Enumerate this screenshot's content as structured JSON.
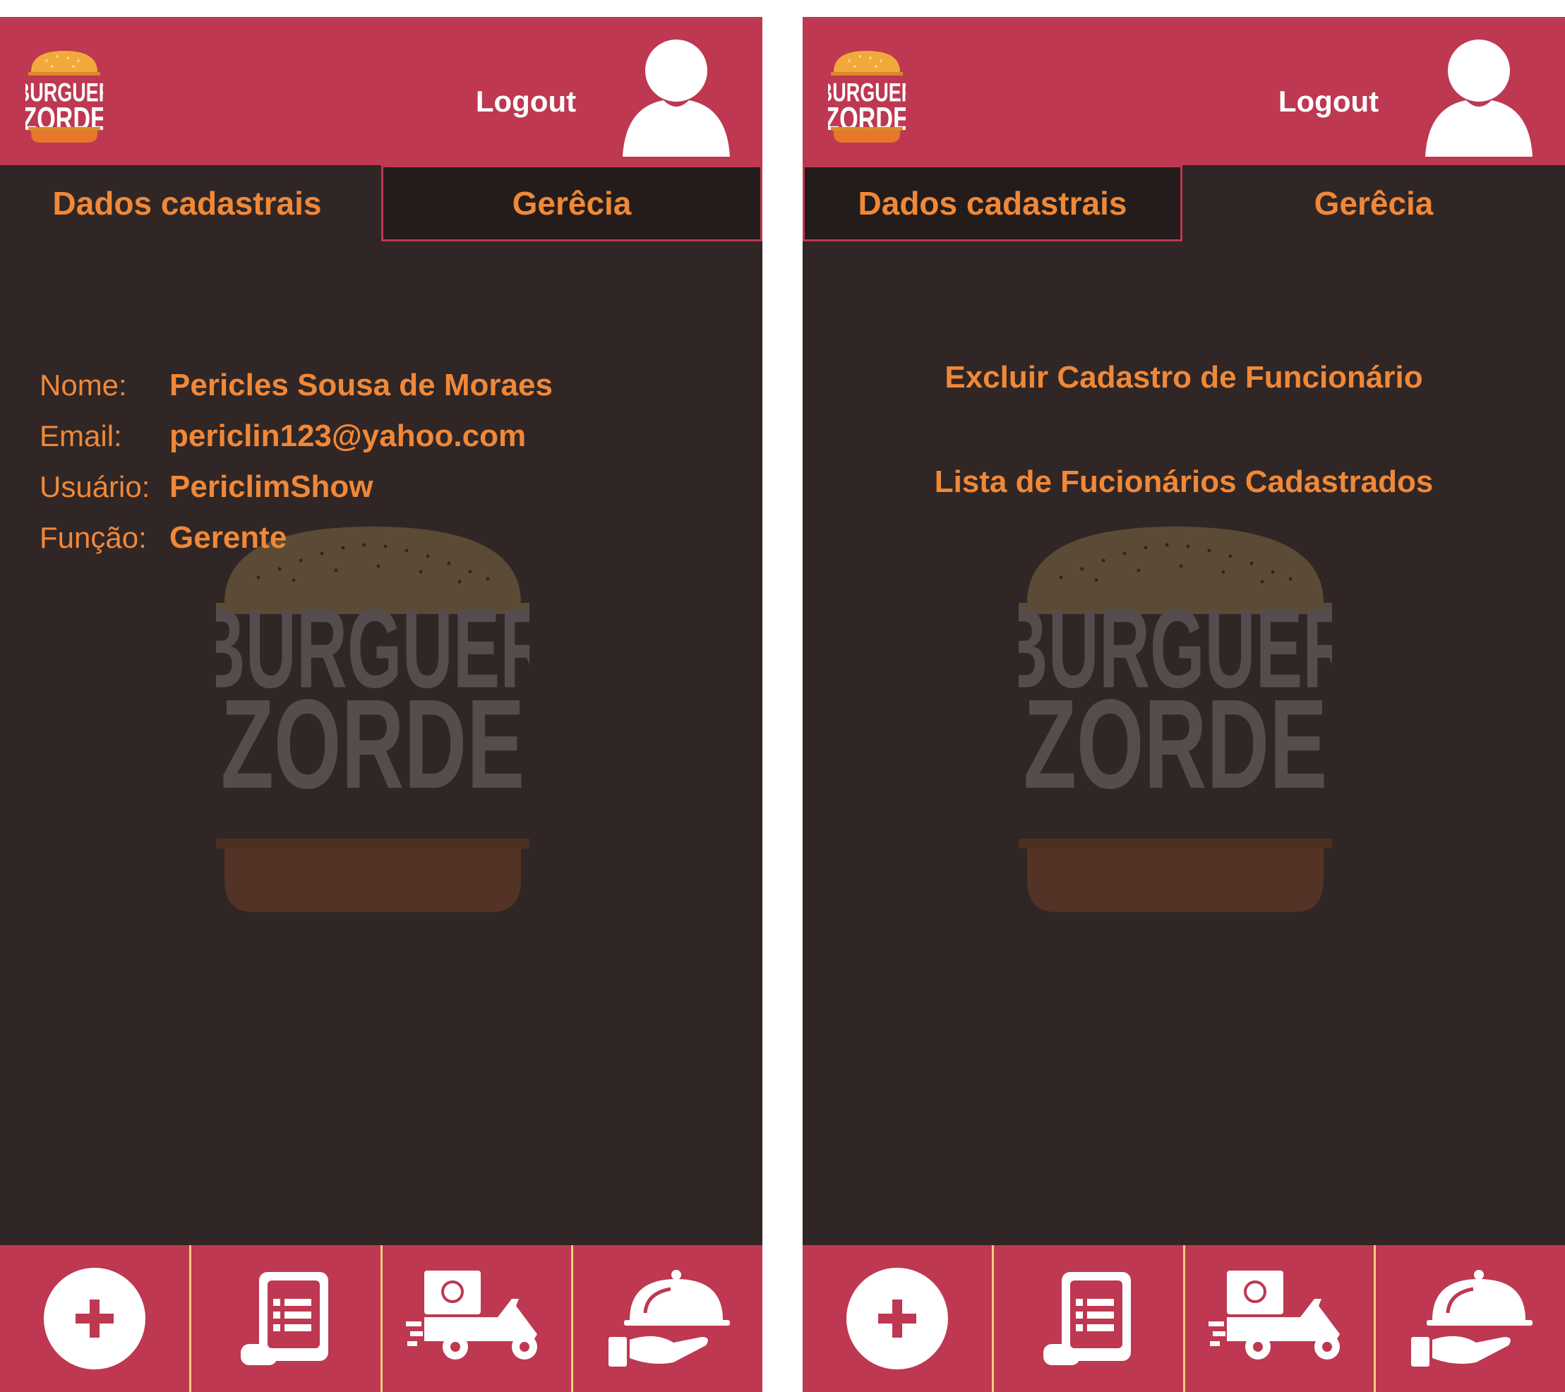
{
  "screens": [
    {
      "header": {
        "logout_label": "Logout"
      },
      "tabs": [
        {
          "label": "Dados cadastrais"
        },
        {
          "label": "Gerêcia"
        }
      ],
      "profile": {
        "rows": [
          {
            "label": "Nome:",
            "value": "Pericles Sousa de Moraes"
          },
          {
            "label": "Email:",
            "value": "periclin123@yahoo.com"
          },
          {
            "label": "Usuário:",
            "value": "PericlimShow"
          },
          {
            "label": "Função:",
            "value": "Gerente"
          }
        ]
      }
    },
    {
      "header": {
        "logout_label": "Logout"
      },
      "tabs": [
        {
          "label": "Dados cadastrais"
        },
        {
          "label": "Gerêcia"
        }
      ],
      "management": {
        "links": [
          {
            "label": "Excluir Cadastro de Funcionário"
          },
          {
            "label": "Lista de Fucionários Cadastrados"
          }
        ]
      }
    }
  ],
  "brand": {
    "logo_text": [
      "BURGUER",
      "ZORDE"
    ]
  },
  "bottom_nav": [
    {
      "icon": "add-circle-icon"
    },
    {
      "icon": "order-list-icon"
    },
    {
      "icon": "delivery-scooter-icon"
    },
    {
      "icon": "serving-cloche-icon"
    }
  ],
  "colors": {
    "header": "#bd3850",
    "background": "#302625",
    "accent": "#f08838",
    "active_tab": "#231c1b",
    "nav_divider": "#f1d174"
  }
}
